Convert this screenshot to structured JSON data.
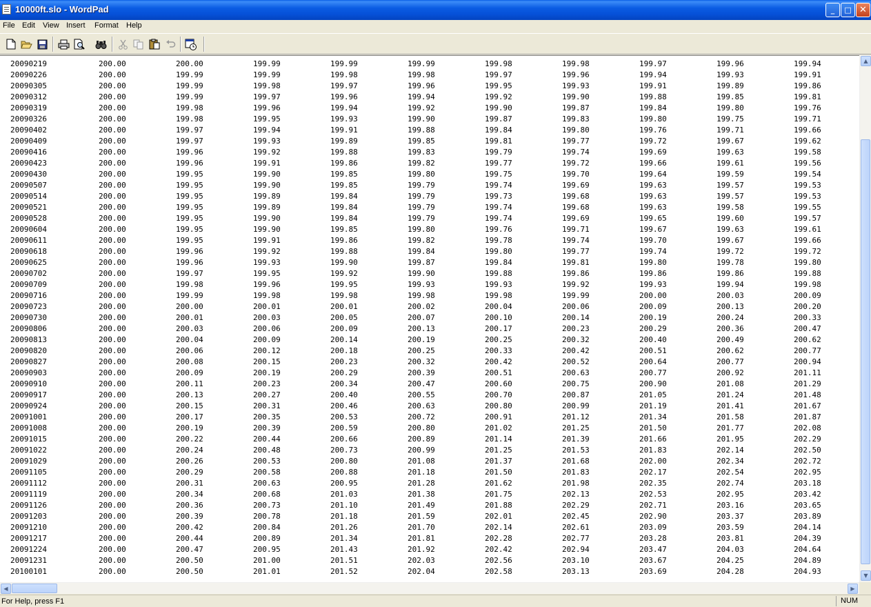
{
  "window": {
    "title": "10000ft.slo - WordPad",
    "minimize_glyph": "_",
    "maximize_glyph": "□",
    "close_glyph": "✕"
  },
  "menu": [
    "File",
    "Edit",
    "View",
    "Insert",
    "Format",
    "Help"
  ],
  "toolbar_icons": [
    "new-icon",
    "open-icon",
    "save-icon",
    "print-icon",
    "print-preview-icon",
    "find-icon",
    "cut-icon",
    "copy-icon",
    "paste-icon",
    "undo-icon",
    "date-time-icon"
  ],
  "rows": [
    [
      "20090219",
      "200.00",
      "200.00",
      "199.99",
      "199.99",
      "199.99",
      "199.98",
      "199.98",
      "199.97",
      "199.96",
      "199.94"
    ],
    [
      "20090226",
      "200.00",
      "199.99",
      "199.99",
      "199.98",
      "199.98",
      "199.97",
      "199.96",
      "199.94",
      "199.93",
      "199.91"
    ],
    [
      "20090305",
      "200.00",
      "199.99",
      "199.98",
      "199.97",
      "199.96",
      "199.95",
      "199.93",
      "199.91",
      "199.89",
      "199.86"
    ],
    [
      "20090312",
      "200.00",
      "199.99",
      "199.97",
      "199.96",
      "199.94",
      "199.92",
      "199.90",
      "199.88",
      "199.85",
      "199.81"
    ],
    [
      "20090319",
      "200.00",
      "199.98",
      "199.96",
      "199.94",
      "199.92",
      "199.90",
      "199.87",
      "199.84",
      "199.80",
      "199.76"
    ],
    [
      "20090326",
      "200.00",
      "199.98",
      "199.95",
      "199.93",
      "199.90",
      "199.87",
      "199.83",
      "199.80",
      "199.75",
      "199.71"
    ],
    [
      "20090402",
      "200.00",
      "199.97",
      "199.94",
      "199.91",
      "199.88",
      "199.84",
      "199.80",
      "199.76",
      "199.71",
      "199.66"
    ],
    [
      "20090409",
      "200.00",
      "199.97",
      "199.93",
      "199.89",
      "199.85",
      "199.81",
      "199.77",
      "199.72",
      "199.67",
      "199.62"
    ],
    [
      "20090416",
      "200.00",
      "199.96",
      "199.92",
      "199.88",
      "199.83",
      "199.79",
      "199.74",
      "199.69",
      "199.63",
      "199.58"
    ],
    [
      "20090423",
      "200.00",
      "199.96",
      "199.91",
      "199.86",
      "199.82",
      "199.77",
      "199.72",
      "199.66",
      "199.61",
      "199.56"
    ],
    [
      "20090430",
      "200.00",
      "199.95",
      "199.90",
      "199.85",
      "199.80",
      "199.75",
      "199.70",
      "199.64",
      "199.59",
      "199.54"
    ],
    [
      "20090507",
      "200.00",
      "199.95",
      "199.90",
      "199.85",
      "199.79",
      "199.74",
      "199.69",
      "199.63",
      "199.57",
      "199.53"
    ],
    [
      "20090514",
      "200.00",
      "199.95",
      "199.89",
      "199.84",
      "199.79",
      "199.73",
      "199.68",
      "199.63",
      "199.57",
      "199.53"
    ],
    [
      "20090521",
      "200.00",
      "199.95",
      "199.89",
      "199.84",
      "199.79",
      "199.74",
      "199.68",
      "199.63",
      "199.58",
      "199.55"
    ],
    [
      "20090528",
      "200.00",
      "199.95",
      "199.90",
      "199.84",
      "199.79",
      "199.74",
      "199.69",
      "199.65",
      "199.60",
      "199.57"
    ],
    [
      "20090604",
      "200.00",
      "199.95",
      "199.90",
      "199.85",
      "199.80",
      "199.76",
      "199.71",
      "199.67",
      "199.63",
      "199.61"
    ],
    [
      "20090611",
      "200.00",
      "199.95",
      "199.91",
      "199.86",
      "199.82",
      "199.78",
      "199.74",
      "199.70",
      "199.67",
      "199.66"
    ],
    [
      "20090618",
      "200.00",
      "199.96",
      "199.92",
      "199.88",
      "199.84",
      "199.80",
      "199.77",
      "199.74",
      "199.72",
      "199.72"
    ],
    [
      "20090625",
      "200.00",
      "199.96",
      "199.93",
      "199.90",
      "199.87",
      "199.84",
      "199.81",
      "199.80",
      "199.78",
      "199.80"
    ],
    [
      "20090702",
      "200.00",
      "199.97",
      "199.95",
      "199.92",
      "199.90",
      "199.88",
      "199.86",
      "199.86",
      "199.86",
      "199.88"
    ],
    [
      "20090709",
      "200.00",
      "199.98",
      "199.96",
      "199.95",
      "199.93",
      "199.93",
      "199.92",
      "199.93",
      "199.94",
      "199.98"
    ],
    [
      "20090716",
      "200.00",
      "199.99",
      "199.98",
      "199.98",
      "199.98",
      "199.98",
      "199.99",
      "200.00",
      "200.03",
      "200.09"
    ],
    [
      "20090723",
      "200.00",
      "200.00",
      "200.01",
      "200.01",
      "200.02",
      "200.04",
      "200.06",
      "200.09",
      "200.13",
      "200.20"
    ],
    [
      "20090730",
      "200.00",
      "200.01",
      "200.03",
      "200.05",
      "200.07",
      "200.10",
      "200.14",
      "200.19",
      "200.24",
      "200.33"
    ],
    [
      "20090806",
      "200.00",
      "200.03",
      "200.06",
      "200.09",
      "200.13",
      "200.17",
      "200.23",
      "200.29",
      "200.36",
      "200.47"
    ],
    [
      "20090813",
      "200.00",
      "200.04",
      "200.09",
      "200.14",
      "200.19",
      "200.25",
      "200.32",
      "200.40",
      "200.49",
      "200.62"
    ],
    [
      "20090820",
      "200.00",
      "200.06",
      "200.12",
      "200.18",
      "200.25",
      "200.33",
      "200.42",
      "200.51",
      "200.62",
      "200.77"
    ],
    [
      "20090827",
      "200.00",
      "200.08",
      "200.15",
      "200.23",
      "200.32",
      "200.42",
      "200.52",
      "200.64",
      "200.77",
      "200.94"
    ],
    [
      "20090903",
      "200.00",
      "200.09",
      "200.19",
      "200.29",
      "200.39",
      "200.51",
      "200.63",
      "200.77",
      "200.92",
      "201.11"
    ],
    [
      "20090910",
      "200.00",
      "200.11",
      "200.23",
      "200.34",
      "200.47",
      "200.60",
      "200.75",
      "200.90",
      "201.08",
      "201.29"
    ],
    [
      "20090917",
      "200.00",
      "200.13",
      "200.27",
      "200.40",
      "200.55",
      "200.70",
      "200.87",
      "201.05",
      "201.24",
      "201.48"
    ],
    [
      "20090924",
      "200.00",
      "200.15",
      "200.31",
      "200.46",
      "200.63",
      "200.80",
      "200.99",
      "201.19",
      "201.41",
      "201.67"
    ],
    [
      "20091001",
      "200.00",
      "200.17",
      "200.35",
      "200.53",
      "200.72",
      "200.91",
      "201.12",
      "201.34",
      "201.58",
      "201.87"
    ],
    [
      "20091008",
      "200.00",
      "200.19",
      "200.39",
      "200.59",
      "200.80",
      "201.02",
      "201.25",
      "201.50",
      "201.77",
      "202.08"
    ],
    [
      "20091015",
      "200.00",
      "200.22",
      "200.44",
      "200.66",
      "200.89",
      "201.14",
      "201.39",
      "201.66",
      "201.95",
      "202.29"
    ],
    [
      "20091022",
      "200.00",
      "200.24",
      "200.48",
      "200.73",
      "200.99",
      "201.25",
      "201.53",
      "201.83",
      "202.14",
      "202.50"
    ],
    [
      "20091029",
      "200.00",
      "200.26",
      "200.53",
      "200.80",
      "201.08",
      "201.37",
      "201.68",
      "202.00",
      "202.34",
      "202.72"
    ],
    [
      "20091105",
      "200.00",
      "200.29",
      "200.58",
      "200.88",
      "201.18",
      "201.50",
      "201.83",
      "202.17",
      "202.54",
      "202.95"
    ],
    [
      "20091112",
      "200.00",
      "200.31",
      "200.63",
      "200.95",
      "201.28",
      "201.62",
      "201.98",
      "202.35",
      "202.74",
      "203.18"
    ],
    [
      "20091119",
      "200.00",
      "200.34",
      "200.68",
      "201.03",
      "201.38",
      "201.75",
      "202.13",
      "202.53",
      "202.95",
      "203.42"
    ],
    [
      "20091126",
      "200.00",
      "200.36",
      "200.73",
      "201.10",
      "201.49",
      "201.88",
      "202.29",
      "202.71",
      "203.16",
      "203.65"
    ],
    [
      "20091203",
      "200.00",
      "200.39",
      "200.78",
      "201.18",
      "201.59",
      "202.01",
      "202.45",
      "202.90",
      "203.37",
      "203.89"
    ],
    [
      "20091210",
      "200.00",
      "200.42",
      "200.84",
      "201.26",
      "201.70",
      "202.14",
      "202.61",
      "203.09",
      "203.59",
      "204.14"
    ],
    [
      "20091217",
      "200.00",
      "200.44",
      "200.89",
      "201.34",
      "201.81",
      "202.28",
      "202.77",
      "203.28",
      "203.81",
      "204.39"
    ],
    [
      "20091224",
      "200.00",
      "200.47",
      "200.95",
      "201.43",
      "201.92",
      "202.42",
      "202.94",
      "203.47",
      "204.03",
      "204.64"
    ],
    [
      "20091231",
      "200.00",
      "200.50",
      "201.00",
      "201.51",
      "202.03",
      "202.56",
      "203.10",
      "203.67",
      "204.25",
      "204.89"
    ],
    [
      "20100101",
      "200.00",
      "200.50",
      "201.01",
      "201.52",
      "202.04",
      "202.58",
      "203.13",
      "203.69",
      "204.28",
      "204.93"
    ]
  ],
  "status": {
    "help_text": "For Help, press F1",
    "num_indicator": "NUM"
  },
  "colors": {
    "titlebar": "#0A5FE6",
    "chrome": "#ECE9D8",
    "document": "#FFFFFF",
    "close_button": "#C4411C"
  }
}
